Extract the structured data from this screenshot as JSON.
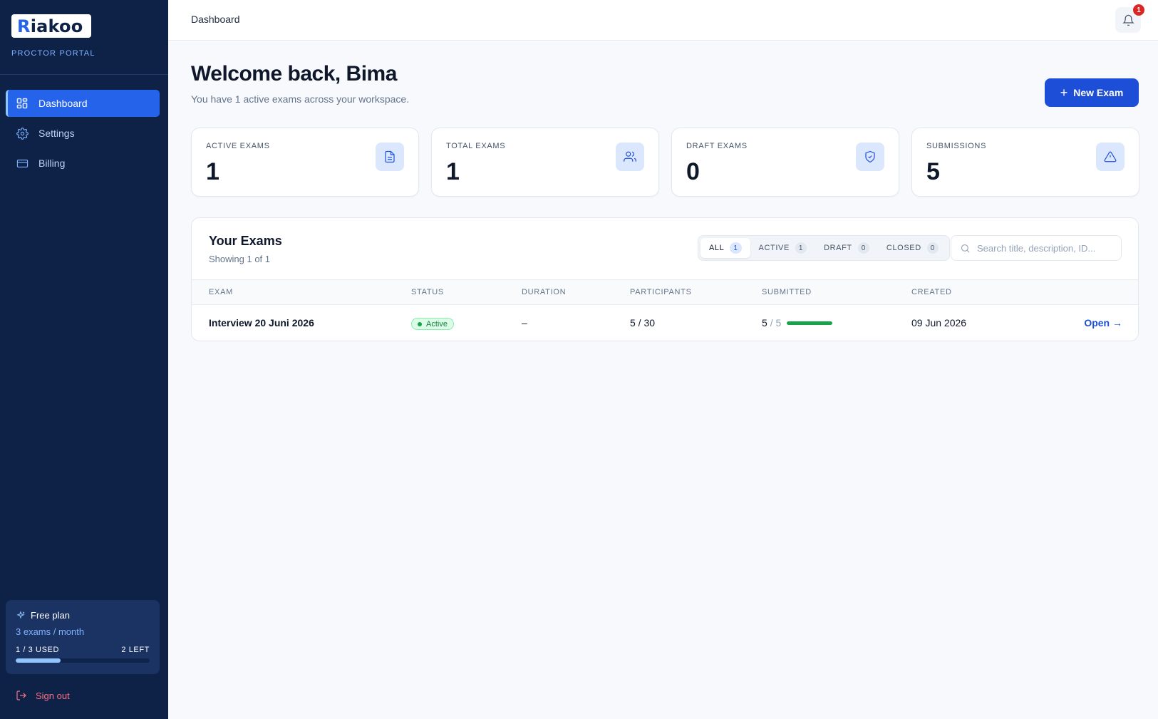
{
  "sidebar": {
    "logo": {
      "initial": "R",
      "rest": "iakoo"
    },
    "portal_label": "PROCTOR PORTAL",
    "nav": [
      {
        "label": "Dashboard",
        "icon": "grid-icon",
        "active": true
      },
      {
        "label": "Settings",
        "icon": "gear-icon",
        "active": false
      },
      {
        "label": "Billing",
        "icon": "credit-card-icon",
        "active": false
      }
    ],
    "plan": {
      "name": "Free plan",
      "quota": "3 exams / month",
      "used_label": "1 / 3 USED",
      "left_label": "2 LEFT",
      "used": 1,
      "total": 3
    },
    "signout_label": "Sign out"
  },
  "topbar": {
    "breadcrumb": "Dashboard",
    "notification_count": "1"
  },
  "main": {
    "welcome": "Welcome back, Bima",
    "subtitle": "You have 1 active exams across your workspace.",
    "new_exam_label": "New Exam",
    "stats": [
      {
        "label": "ACTIVE EXAMS",
        "value": "1",
        "icon": "document-icon"
      },
      {
        "label": "TOTAL EXAMS",
        "value": "1",
        "icon": "users-icon"
      },
      {
        "label": "DRAFT EXAMS",
        "value": "0",
        "icon": "shield-check-icon"
      },
      {
        "label": "SUBMISSIONS",
        "value": "5",
        "icon": "alert-triangle-icon"
      }
    ],
    "exams": {
      "title": "Your Exams",
      "showing": "Showing 1 of 1",
      "filters": [
        {
          "label": "ALL",
          "count": "1",
          "active": true
        },
        {
          "label": "ACTIVE",
          "count": "1",
          "active": false
        },
        {
          "label": "DRAFT",
          "count": "0",
          "active": false
        },
        {
          "label": "CLOSED",
          "count": "0",
          "active": false
        }
      ],
      "search_placeholder": "Search title, description, ID...",
      "columns": [
        "EXAM",
        "STATUS",
        "DURATION",
        "PARTICIPANTS",
        "SUBMITTED",
        "CREATED"
      ],
      "rows": [
        {
          "name": "Interview 20 Juni 2026",
          "status": "Active",
          "duration": "–",
          "participants": "5 / 30",
          "submitted_count": "5",
          "submitted_sep": "/ 5",
          "submitted_fraction": 1.0,
          "created": "09 Jun 2026",
          "action": "Open →"
        }
      ]
    }
  },
  "colors": {
    "sidebar_bg": "#0e2248",
    "primary": "#1d4ed8",
    "success": "#16a34a",
    "danger": "#dc2626"
  }
}
